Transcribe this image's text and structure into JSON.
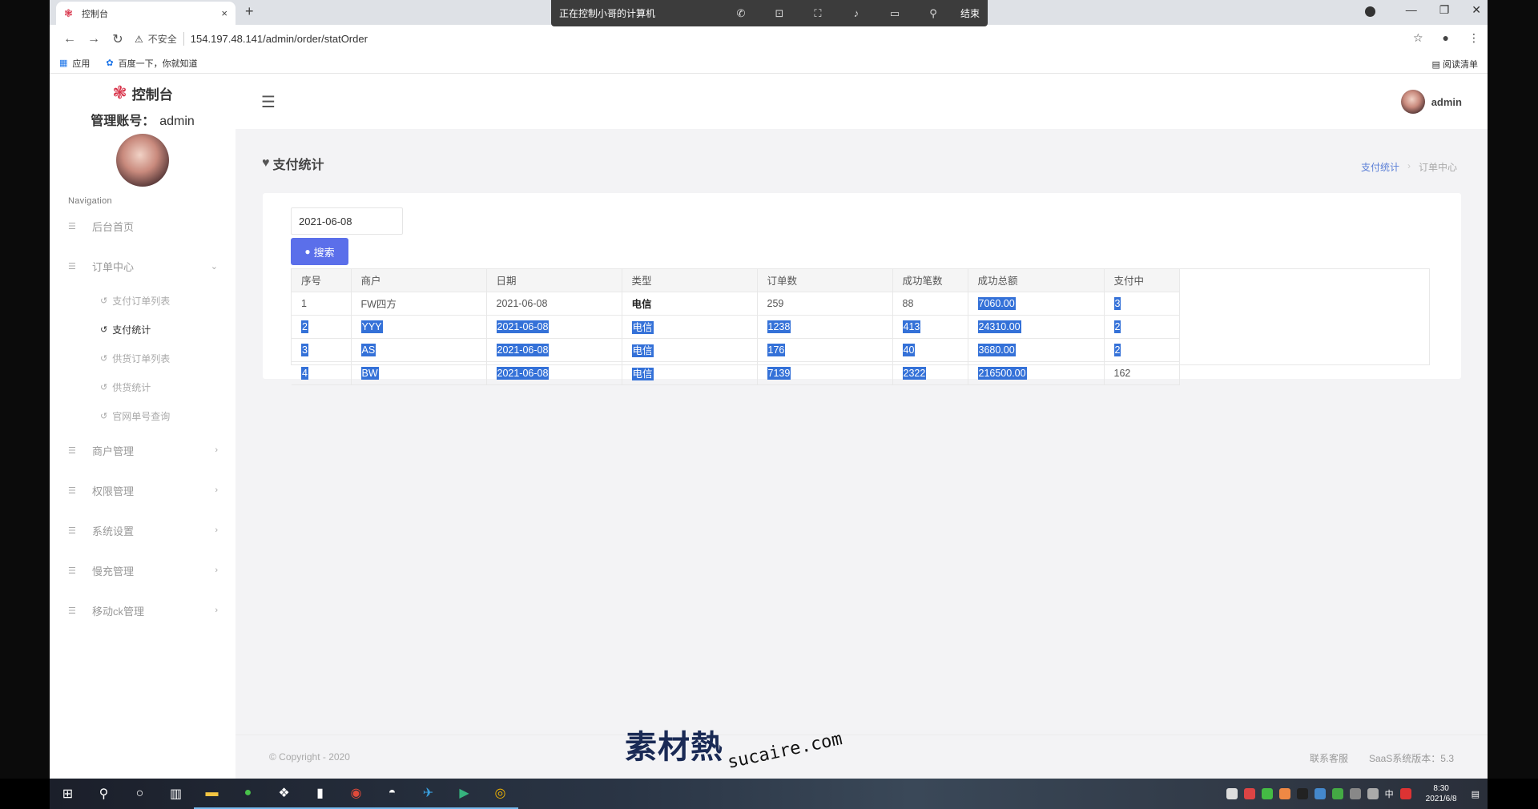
{
  "browser": {
    "tab_title": "控制台",
    "tab_close": "×",
    "new_tab": "+",
    "remote_bar_title": "正在控制小哥的计算机",
    "remote_bar_end": "结束",
    "insecure_label": "不安全",
    "url": "154.197.48.141/admin/order/statOrder",
    "bookmarks": [
      {
        "label": "应用",
        "icon": "apps-grid-icon"
      },
      {
        "label": "百度一下，你就知道",
        "icon": "baidu-paw-icon"
      }
    ],
    "reading_list": "阅读清单"
  },
  "sidebar": {
    "brand": "控制台",
    "account_label": "管理账号：",
    "account_value": "admin",
    "nav_label": "Navigation",
    "items": [
      {
        "label": "后台首页",
        "has_children": false
      },
      {
        "label": "订单中心",
        "has_children": true,
        "expanded": true
      },
      {
        "label": "商户管理",
        "has_children": true
      },
      {
        "label": "权限管理",
        "has_children": true
      },
      {
        "label": "系统设置",
        "has_children": true
      },
      {
        "label": "慢充管理",
        "has_children": true
      },
      {
        "label": "移动ck管理",
        "has_children": true
      }
    ],
    "sub_items": [
      {
        "label": "支付订单列表",
        "active": false
      },
      {
        "label": "支付统计",
        "active": true
      },
      {
        "label": "供货订单列表",
        "active": false
      },
      {
        "label": "供货统计",
        "active": false
      },
      {
        "label": "官网单号查询",
        "active": false
      }
    ]
  },
  "header": {
    "user": "admin"
  },
  "page": {
    "title": "支付统计",
    "breadcrumb": [
      "支付统计",
      "订单中心"
    ],
    "date_value": "2021-06-08",
    "search_label": "搜索"
  },
  "table": {
    "columns": [
      "序号",
      "商户",
      "日期",
      "类型",
      "订单数",
      "成功笔数",
      "成功总额",
      "支付中"
    ],
    "rows": [
      [
        "1",
        "FW四方",
        "2021-06-08",
        "电信",
        "259",
        "88",
        "7060.00",
        "3"
      ],
      [
        "2",
        "YYY",
        "2021-06-08",
        "电信",
        "1238",
        "413",
        "24310.00",
        "2"
      ],
      [
        "3",
        "AS",
        "2021-06-08",
        "电信",
        "176",
        "40",
        "3680.00",
        "2"
      ],
      [
        "4",
        "BW",
        "2021-06-08",
        "电信",
        "7139",
        "2322",
        "216500.00",
        "162"
      ]
    ]
  },
  "footer": {
    "copyright": "© Copyright - 2020",
    "contact": "联系客服",
    "version": "SaaS系统版本：5.3"
  },
  "watermark": {
    "cn": "素材熱",
    "en": "sucaire.com"
  },
  "taskbar": {
    "time": "8:30",
    "date": "2021/6/8",
    "ime": "中"
  },
  "colors": {
    "accent": "#5b6fea",
    "selection": "#3471d8",
    "brand_red": "#d8334a",
    "breadcrumb_link": "#5b7fd6"
  }
}
